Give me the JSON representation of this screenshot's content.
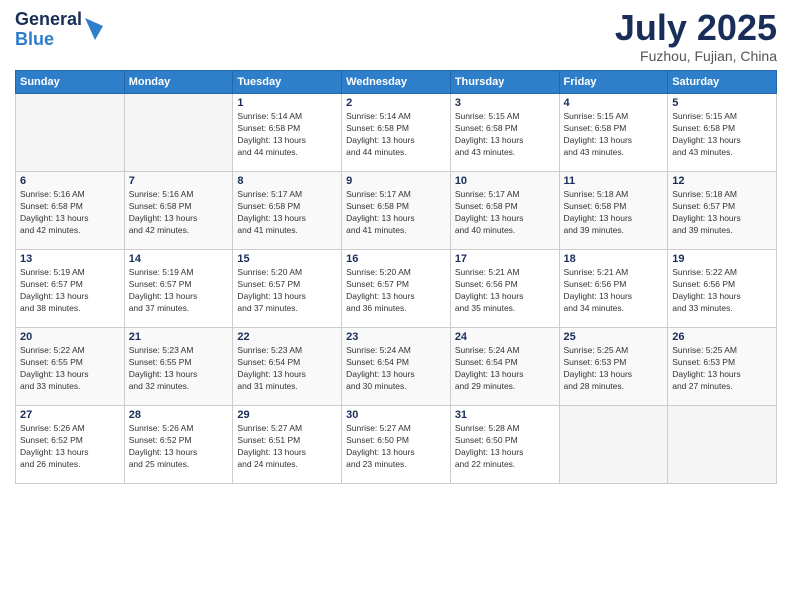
{
  "header": {
    "logo_general": "General",
    "logo_blue": "Blue",
    "month_title": "July 2025",
    "location": "Fuzhou, Fujian, China"
  },
  "weekdays": [
    "Sunday",
    "Monday",
    "Tuesday",
    "Wednesday",
    "Thursday",
    "Friday",
    "Saturday"
  ],
  "weeks": [
    [
      {
        "day": "",
        "info": ""
      },
      {
        "day": "",
        "info": ""
      },
      {
        "day": "1",
        "info": "Sunrise: 5:14 AM\nSunset: 6:58 PM\nDaylight: 13 hours\nand 44 minutes."
      },
      {
        "day": "2",
        "info": "Sunrise: 5:14 AM\nSunset: 6:58 PM\nDaylight: 13 hours\nand 44 minutes."
      },
      {
        "day": "3",
        "info": "Sunrise: 5:15 AM\nSunset: 6:58 PM\nDaylight: 13 hours\nand 43 minutes."
      },
      {
        "day": "4",
        "info": "Sunrise: 5:15 AM\nSunset: 6:58 PM\nDaylight: 13 hours\nand 43 minutes."
      },
      {
        "day": "5",
        "info": "Sunrise: 5:15 AM\nSunset: 6:58 PM\nDaylight: 13 hours\nand 43 minutes."
      }
    ],
    [
      {
        "day": "6",
        "info": "Sunrise: 5:16 AM\nSunset: 6:58 PM\nDaylight: 13 hours\nand 42 minutes."
      },
      {
        "day": "7",
        "info": "Sunrise: 5:16 AM\nSunset: 6:58 PM\nDaylight: 13 hours\nand 42 minutes."
      },
      {
        "day": "8",
        "info": "Sunrise: 5:17 AM\nSunset: 6:58 PM\nDaylight: 13 hours\nand 41 minutes."
      },
      {
        "day": "9",
        "info": "Sunrise: 5:17 AM\nSunset: 6:58 PM\nDaylight: 13 hours\nand 41 minutes."
      },
      {
        "day": "10",
        "info": "Sunrise: 5:17 AM\nSunset: 6:58 PM\nDaylight: 13 hours\nand 40 minutes."
      },
      {
        "day": "11",
        "info": "Sunrise: 5:18 AM\nSunset: 6:58 PM\nDaylight: 13 hours\nand 39 minutes."
      },
      {
        "day": "12",
        "info": "Sunrise: 5:18 AM\nSunset: 6:57 PM\nDaylight: 13 hours\nand 39 minutes."
      }
    ],
    [
      {
        "day": "13",
        "info": "Sunrise: 5:19 AM\nSunset: 6:57 PM\nDaylight: 13 hours\nand 38 minutes."
      },
      {
        "day": "14",
        "info": "Sunrise: 5:19 AM\nSunset: 6:57 PM\nDaylight: 13 hours\nand 37 minutes."
      },
      {
        "day": "15",
        "info": "Sunrise: 5:20 AM\nSunset: 6:57 PM\nDaylight: 13 hours\nand 37 minutes."
      },
      {
        "day": "16",
        "info": "Sunrise: 5:20 AM\nSunset: 6:57 PM\nDaylight: 13 hours\nand 36 minutes."
      },
      {
        "day": "17",
        "info": "Sunrise: 5:21 AM\nSunset: 6:56 PM\nDaylight: 13 hours\nand 35 minutes."
      },
      {
        "day": "18",
        "info": "Sunrise: 5:21 AM\nSunset: 6:56 PM\nDaylight: 13 hours\nand 34 minutes."
      },
      {
        "day": "19",
        "info": "Sunrise: 5:22 AM\nSunset: 6:56 PM\nDaylight: 13 hours\nand 33 minutes."
      }
    ],
    [
      {
        "day": "20",
        "info": "Sunrise: 5:22 AM\nSunset: 6:55 PM\nDaylight: 13 hours\nand 33 minutes."
      },
      {
        "day": "21",
        "info": "Sunrise: 5:23 AM\nSunset: 6:55 PM\nDaylight: 13 hours\nand 32 minutes."
      },
      {
        "day": "22",
        "info": "Sunrise: 5:23 AM\nSunset: 6:54 PM\nDaylight: 13 hours\nand 31 minutes."
      },
      {
        "day": "23",
        "info": "Sunrise: 5:24 AM\nSunset: 6:54 PM\nDaylight: 13 hours\nand 30 minutes."
      },
      {
        "day": "24",
        "info": "Sunrise: 5:24 AM\nSunset: 6:54 PM\nDaylight: 13 hours\nand 29 minutes."
      },
      {
        "day": "25",
        "info": "Sunrise: 5:25 AM\nSunset: 6:53 PM\nDaylight: 13 hours\nand 28 minutes."
      },
      {
        "day": "26",
        "info": "Sunrise: 5:25 AM\nSunset: 6:53 PM\nDaylight: 13 hours\nand 27 minutes."
      }
    ],
    [
      {
        "day": "27",
        "info": "Sunrise: 5:26 AM\nSunset: 6:52 PM\nDaylight: 13 hours\nand 26 minutes."
      },
      {
        "day": "28",
        "info": "Sunrise: 5:26 AM\nSunset: 6:52 PM\nDaylight: 13 hours\nand 25 minutes."
      },
      {
        "day": "29",
        "info": "Sunrise: 5:27 AM\nSunset: 6:51 PM\nDaylight: 13 hours\nand 24 minutes."
      },
      {
        "day": "30",
        "info": "Sunrise: 5:27 AM\nSunset: 6:50 PM\nDaylight: 13 hours\nand 23 minutes."
      },
      {
        "day": "31",
        "info": "Sunrise: 5:28 AM\nSunset: 6:50 PM\nDaylight: 13 hours\nand 22 minutes."
      },
      {
        "day": "",
        "info": ""
      },
      {
        "day": "",
        "info": ""
      }
    ]
  ]
}
